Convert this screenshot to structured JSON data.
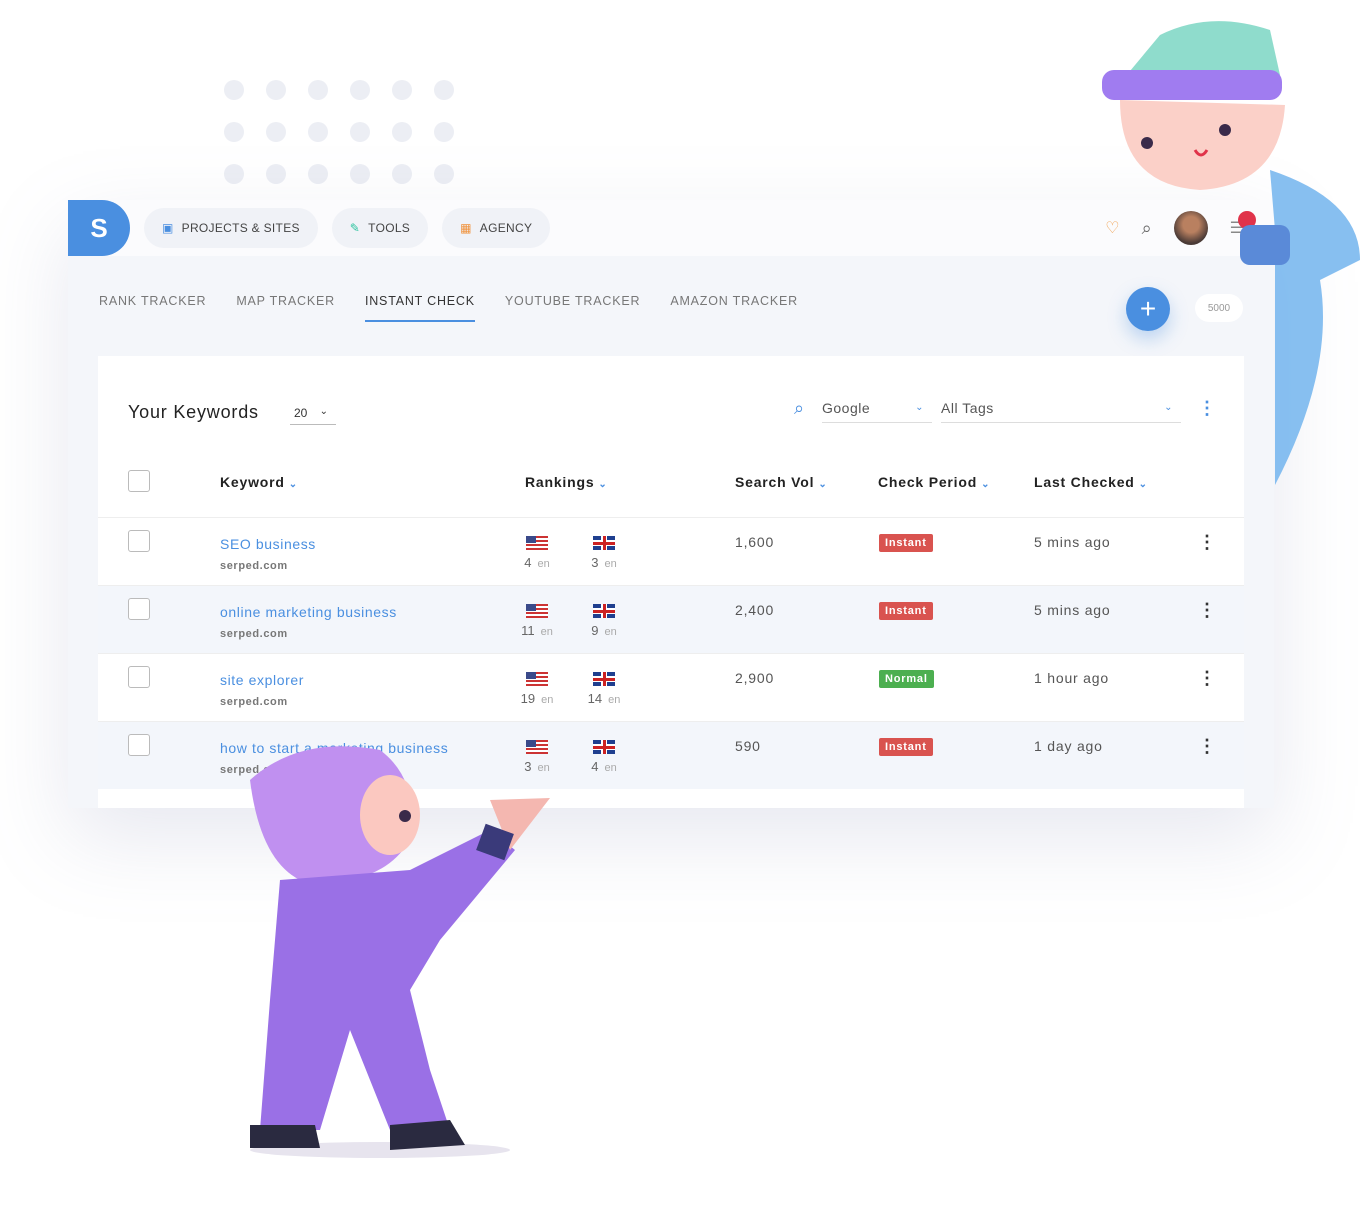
{
  "nav": {
    "logo": "S",
    "pills": [
      {
        "label": "PROJECTS & SITES",
        "icon": "briefcase-icon",
        "color": "#4a8fe0"
      },
      {
        "label": "TOOLS",
        "icon": "wrench-icon",
        "color": "#2ec4a0"
      },
      {
        "label": "AGENCY",
        "icon": "building-icon",
        "color": "#f0913a"
      }
    ],
    "badge_count": ""
  },
  "tabs": [
    {
      "label": "RANK TRACKER"
    },
    {
      "label": "MAP TRACKER"
    },
    {
      "label": "INSTANT CHECK",
      "active": true
    },
    {
      "label": "YOUTUBE TRACKER"
    },
    {
      "label": "AMAZON TRACKER"
    }
  ],
  "credits": "5000",
  "card": {
    "title": "Your Keywords",
    "count": "20",
    "engine": "Google",
    "tags": "All Tags"
  },
  "columns": [
    "Keyword",
    "Rankings",
    "Search Vol",
    "Check Period",
    "Last Checked"
  ],
  "rows": [
    {
      "keyword": "SEO business",
      "domain": "serped.com",
      "us": "4",
      "uk": "3",
      "lang": "en",
      "vol": "1,600",
      "period": "Instant",
      "last": "5 mins ago"
    },
    {
      "keyword": "online marketing business",
      "domain": "serped.com",
      "us": "11",
      "uk": "9",
      "lang": "en",
      "vol": "2,400",
      "period": "Instant",
      "last": "5 mins ago"
    },
    {
      "keyword": "site explorer",
      "domain": "serped.com",
      "us": "19",
      "uk": "14",
      "lang": "en",
      "vol": "2,900",
      "period": "Normal",
      "last": "1 hour ago"
    },
    {
      "keyword": "how to start a marketing business",
      "domain": "serped.com",
      "us": "3",
      "uk": "4",
      "lang": "en",
      "vol": "590",
      "period": "Instant",
      "last": "1 day ago"
    }
  ],
  "colors": {
    "accent": "#4a8fe0",
    "instant": "#d9534f",
    "normal": "#4caf50"
  }
}
